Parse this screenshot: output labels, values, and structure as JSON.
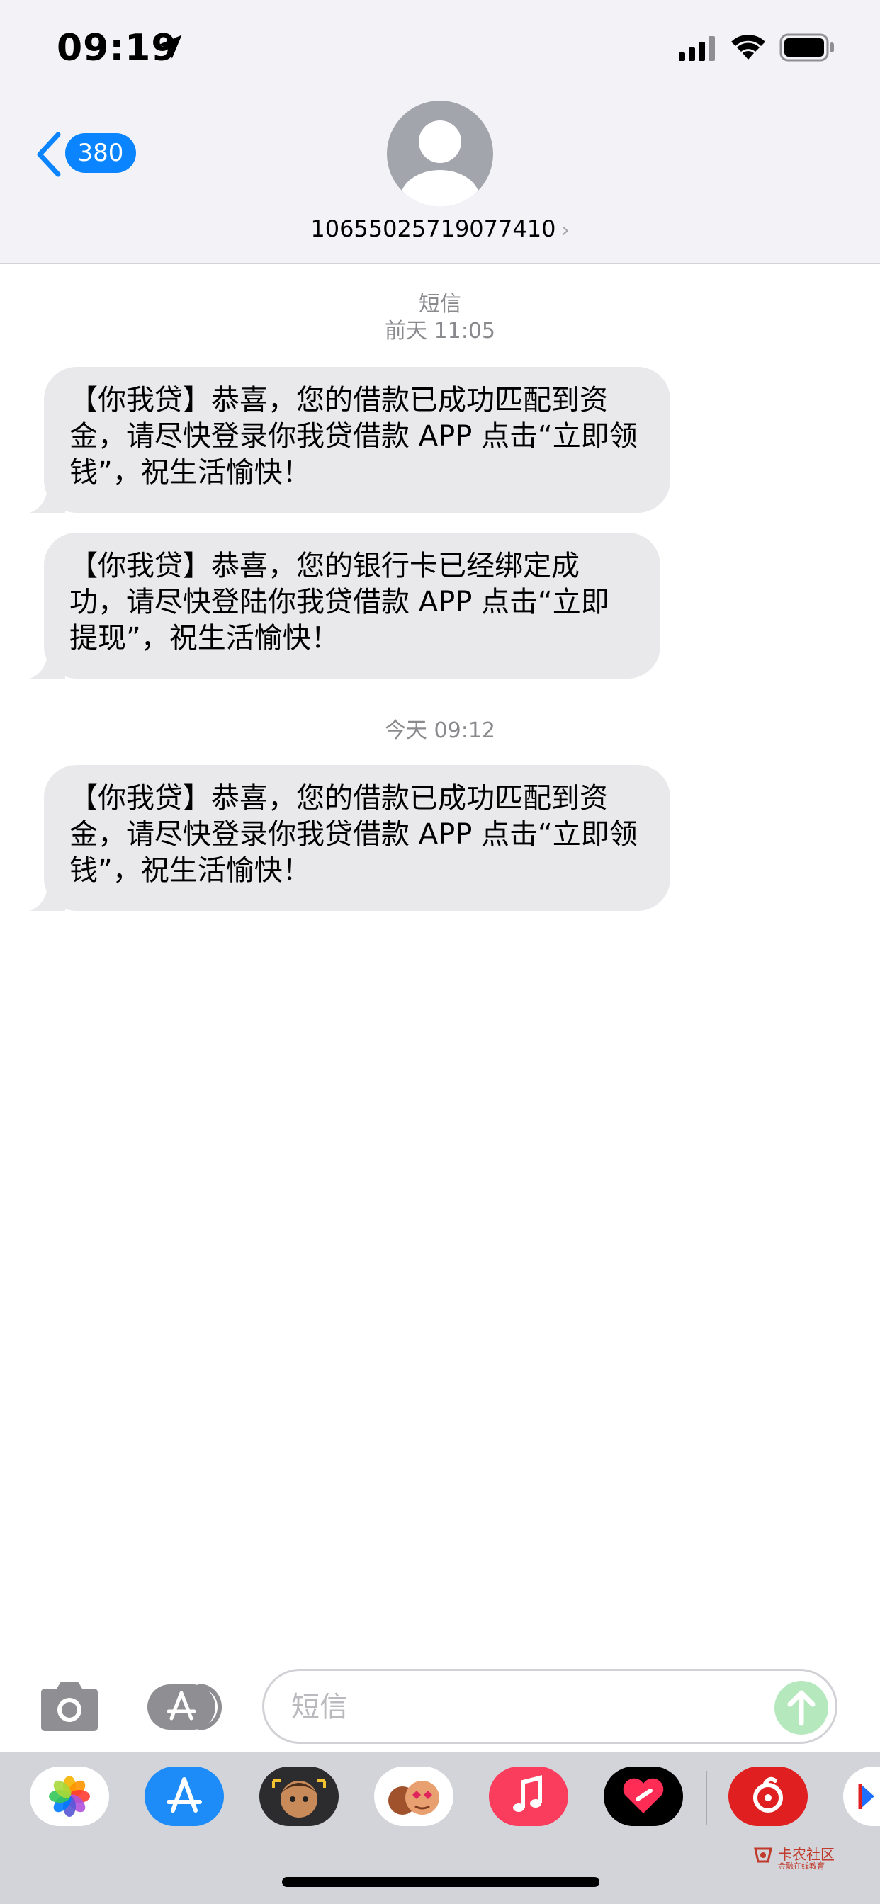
{
  "status_bar": {
    "time": "09:19"
  },
  "nav": {
    "back_count": "380",
    "contact_number": "10655025719077410",
    "contact_chevron": "›"
  },
  "conversation": {
    "service_label": "短信",
    "groups": [
      {
        "timestamp": "前天 11:05",
        "messages": [
          "【你我贷】恭喜，您的借款已成功匹配到资金，请尽快登录你我贷借款 APP 点击“立即领钱”，祝生活愉快！",
          "【你我贷】恭喜，您的银行卡已经绑定成功，请尽快登陆你我贷借款 APP 点击“立即提现”，祝生活愉快！"
        ]
      },
      {
        "timestamp": "今天 09:12",
        "messages": [
          "【你我贷】恭喜，您的借款已成功匹配到资金，请尽快登录你我贷借款 APP 点击“立即领钱”，祝生活愉快！"
        ]
      }
    ]
  },
  "compose": {
    "placeholder": "短信"
  },
  "app_drawer": {
    "apps": [
      "photos",
      "app-store",
      "memoji-stickers",
      "animoji",
      "music",
      "digital-touch",
      "netease-music",
      "video-app"
    ]
  },
  "watermark": {
    "text": "卡农社区",
    "subtext": "金融在线教育"
  },
  "colors": {
    "accent": "#0a84ff",
    "bubble_received": "#e9e9eb",
    "header_bg": "#f2f2f7",
    "drawer_bg": "#d3d4d9"
  }
}
